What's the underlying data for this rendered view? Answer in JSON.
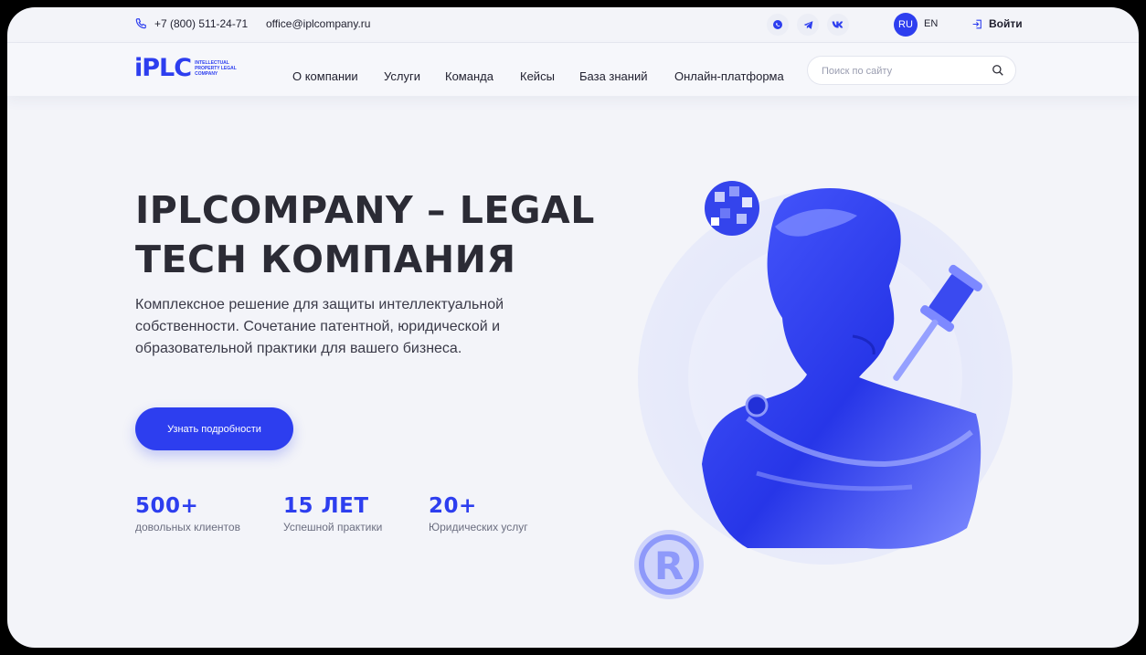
{
  "topbar": {
    "phone": "+7 (800) 511-24-71",
    "email": "office@iplcompany.ru",
    "social": [
      "whatsapp-icon",
      "telegram-icon",
      "vk-icon"
    ],
    "lang_active": "RU",
    "lang_other": "EN",
    "login_label": "Войти"
  },
  "nav": {
    "logo_text": "iPLC",
    "logo_sub": "INTELLECTUAL PROPERTY LEGAL COMPANY",
    "items": [
      "О компании",
      "Услуги",
      "Команда",
      "Кейсы",
      "База знаний",
      "Онлайн-платформа"
    ],
    "search_placeholder": "Поиск по сайту"
  },
  "hero": {
    "title_line1": "IPLCOMPANY – LEGAL",
    "title_line2": "TECH КОМПАНИЯ",
    "description": "Комплексное решение для защиты интеллектуальной собственности. Сочетание патентной, юридической и образовательной практики для вашего бизнеса.",
    "cta_label": "Узнать подробности",
    "stats": [
      {
        "value": "500+",
        "label": "довольных клиентов"
      },
      {
        "value": "15 ЛЕТ",
        "label": "Успешной практики"
      },
      {
        "value": "20+",
        "label": "Юридических услуг"
      }
    ]
  },
  "colors": {
    "accent": "#2d3eef",
    "background": "#f3f4f9",
    "text": "#2b2b35"
  }
}
